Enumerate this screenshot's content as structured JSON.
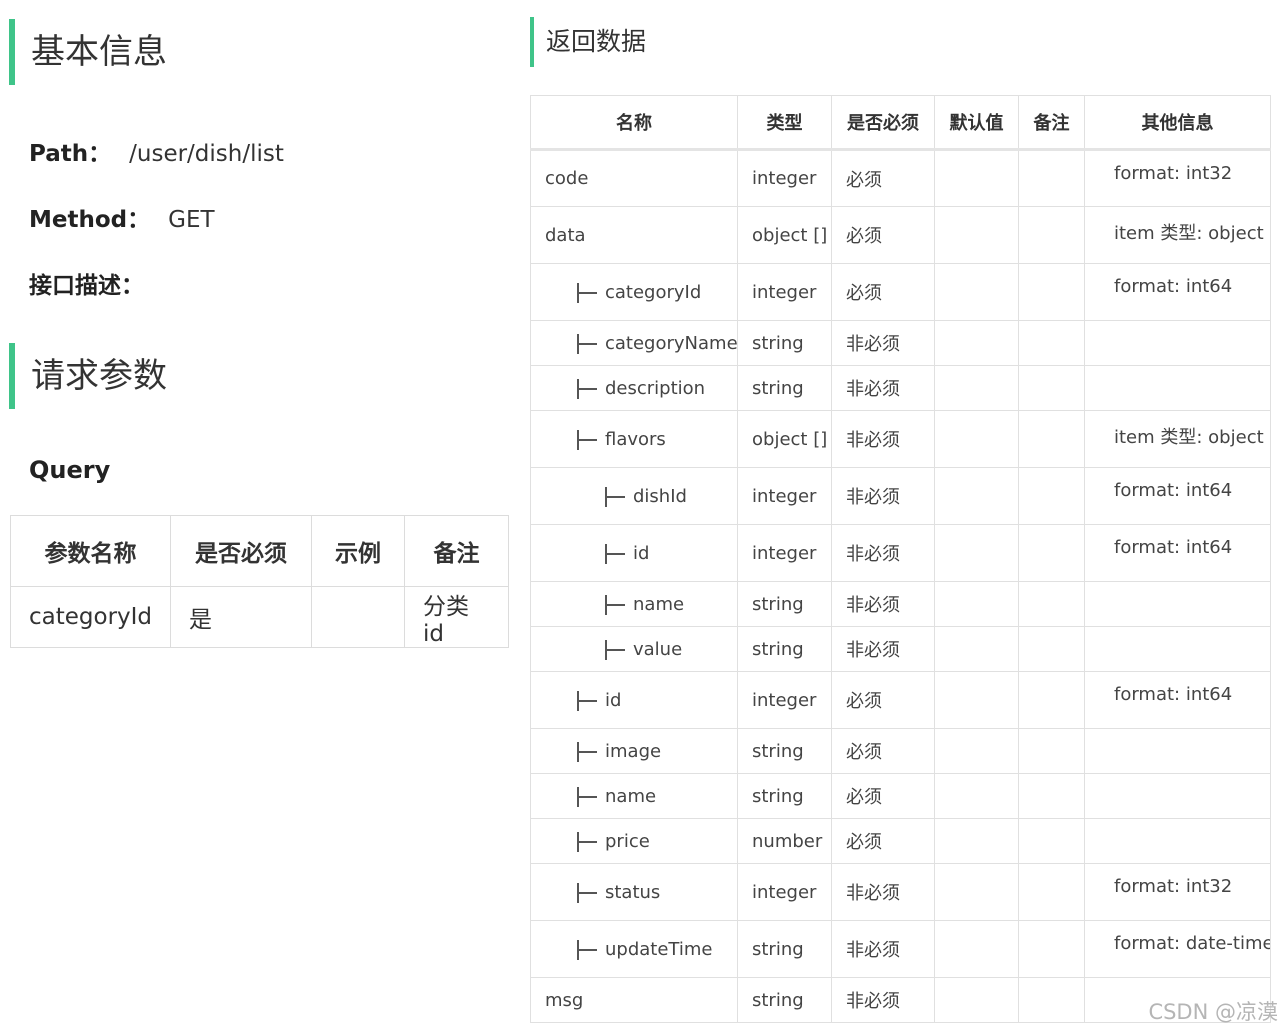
{
  "basic": {
    "title": "基本信息",
    "path_label": "Path：",
    "path_value": "/user/dish/list",
    "method_label": "Method：",
    "method_value": "GET",
    "desc_label": "接口描述："
  },
  "request": {
    "title": "请求参数",
    "query_title": "Query",
    "headers": [
      "参数名称",
      "是否必须",
      "示例",
      "备注"
    ],
    "rows": [
      [
        "categoryId",
        "是",
        "",
        "分类id"
      ]
    ]
  },
  "response": {
    "title": "返回数据",
    "headers": [
      "名称",
      "类型",
      "是否必须",
      "默认值",
      "备注",
      "其他信息"
    ],
    "rows": [
      {
        "name": "code",
        "type": "integer",
        "required": "必须",
        "default": "",
        "remark": "",
        "other": "format: int32"
      },
      {
        "name": "data",
        "type": "object []",
        "required": "必须",
        "default": "",
        "remark": "",
        "other": "item 类型: object"
      },
      {
        "name": "categoryId",
        "type": "integer",
        "required": "必须",
        "default": "",
        "remark": "",
        "other": "format: int64"
      },
      {
        "name": "categoryName",
        "type": "string",
        "required": "非必须",
        "default": "",
        "remark": "",
        "other": ""
      },
      {
        "name": "description",
        "type": "string",
        "required": "非必须",
        "default": "",
        "remark": "",
        "other": ""
      },
      {
        "name": "flavors",
        "type": "object []",
        "required": "非必须",
        "default": "",
        "remark": "",
        "other": "item 类型: object"
      },
      {
        "name": "dishId",
        "type": "integer",
        "required": "非必须",
        "default": "",
        "remark": "",
        "other": "format: int64"
      },
      {
        "name": "id",
        "type": "integer",
        "required": "非必须",
        "default": "",
        "remark": "",
        "other": "format: int64"
      },
      {
        "name": "name",
        "type": "string",
        "required": "非必须",
        "default": "",
        "remark": "",
        "other": ""
      },
      {
        "name": "value",
        "type": "string",
        "required": "非必须",
        "default": "",
        "remark": "",
        "other": ""
      },
      {
        "name": "id",
        "type": "integer",
        "required": "必须",
        "default": "",
        "remark": "",
        "other": "format: int64"
      },
      {
        "name": "image",
        "type": "string",
        "required": "必须",
        "default": "",
        "remark": "",
        "other": ""
      },
      {
        "name": "name",
        "type": "string",
        "required": "必须",
        "default": "",
        "remark": "",
        "other": ""
      },
      {
        "name": "price",
        "type": "number",
        "required": "必须",
        "default": "",
        "remark": "",
        "other": ""
      },
      {
        "name": "status",
        "type": "integer",
        "required": "非必须",
        "default": "",
        "remark": "",
        "other": "format: int32"
      },
      {
        "name": "updateTime",
        "type": "string",
        "required": "非必须",
        "default": "",
        "remark": "",
        "other": "format: date-time"
      },
      {
        "name": "msg",
        "type": "string",
        "required": "非必须",
        "default": "",
        "remark": "",
        "other": ""
      }
    ]
  },
  "watermark": "CSDN @凉漠",
  "colors": {
    "accent": "#3fc489",
    "border": "#e0e0e0",
    "text": "#333333"
  }
}
